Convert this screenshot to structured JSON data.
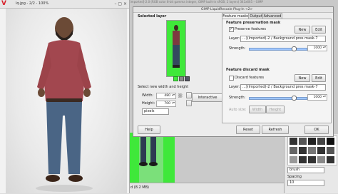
{
  "image_window": {
    "title": "lq.jpg - 2/2 - 100%",
    "controls": "– ▢ ×"
  },
  "backdrop": {
    "title_fragment": "[imported]-2.0 (RGB color 8-bit gamma integer, GIMP built-in sRGB, 2 layers) 341x665 – GIMP",
    "status": "d (8.2 MB)"
  },
  "dialog": {
    "title": "GIMP LiquidRescale Plug-In <2>",
    "selected_layer_heading": "Selected layer",
    "size_heading": "Select new width and height",
    "width_label": "Width:",
    "width_value": "480",
    "height_label": "Height:",
    "height_value": "700",
    "unit_value": "pixels",
    "interactive_label": "Interactive",
    "help_label": "Help",
    "reset_label": "Reset",
    "refresh_label": "Refresh",
    "ok_label": "OK",
    "tabs": [
      "Feature masks",
      "Output",
      "Advanced"
    ],
    "preservation": {
      "heading": "Feature preservation mask",
      "checkbox_label": "Preserve features",
      "new_label": "New",
      "edit_label": "Edit",
      "layer_label": "Layer:",
      "layer_value": "...)(Imported)-2 / Background pres mask-7",
      "strength_label": "Strength:",
      "strength_value": "1000"
    },
    "discard": {
      "heading": "Feature discard mask",
      "checkbox_label": "Discard features",
      "new_label": "New",
      "edit_label": "Edit",
      "layer_label": "Layer:",
      "layer_value": "...)(Imported)-2 / Background pres mask-7",
      "strength_label": "Strength:",
      "strength_value": "1000",
      "auto_size_label": "Auto size:",
      "width_label": "Width",
      "height_label": "Height"
    }
  },
  "right_panel": {
    "brush_name": "brush",
    "spacing_label": "Spacing",
    "spacing_value": "10"
  },
  "colors": {
    "mask_green": "#3fe83a",
    "title_accent": "#d8202a"
  }
}
